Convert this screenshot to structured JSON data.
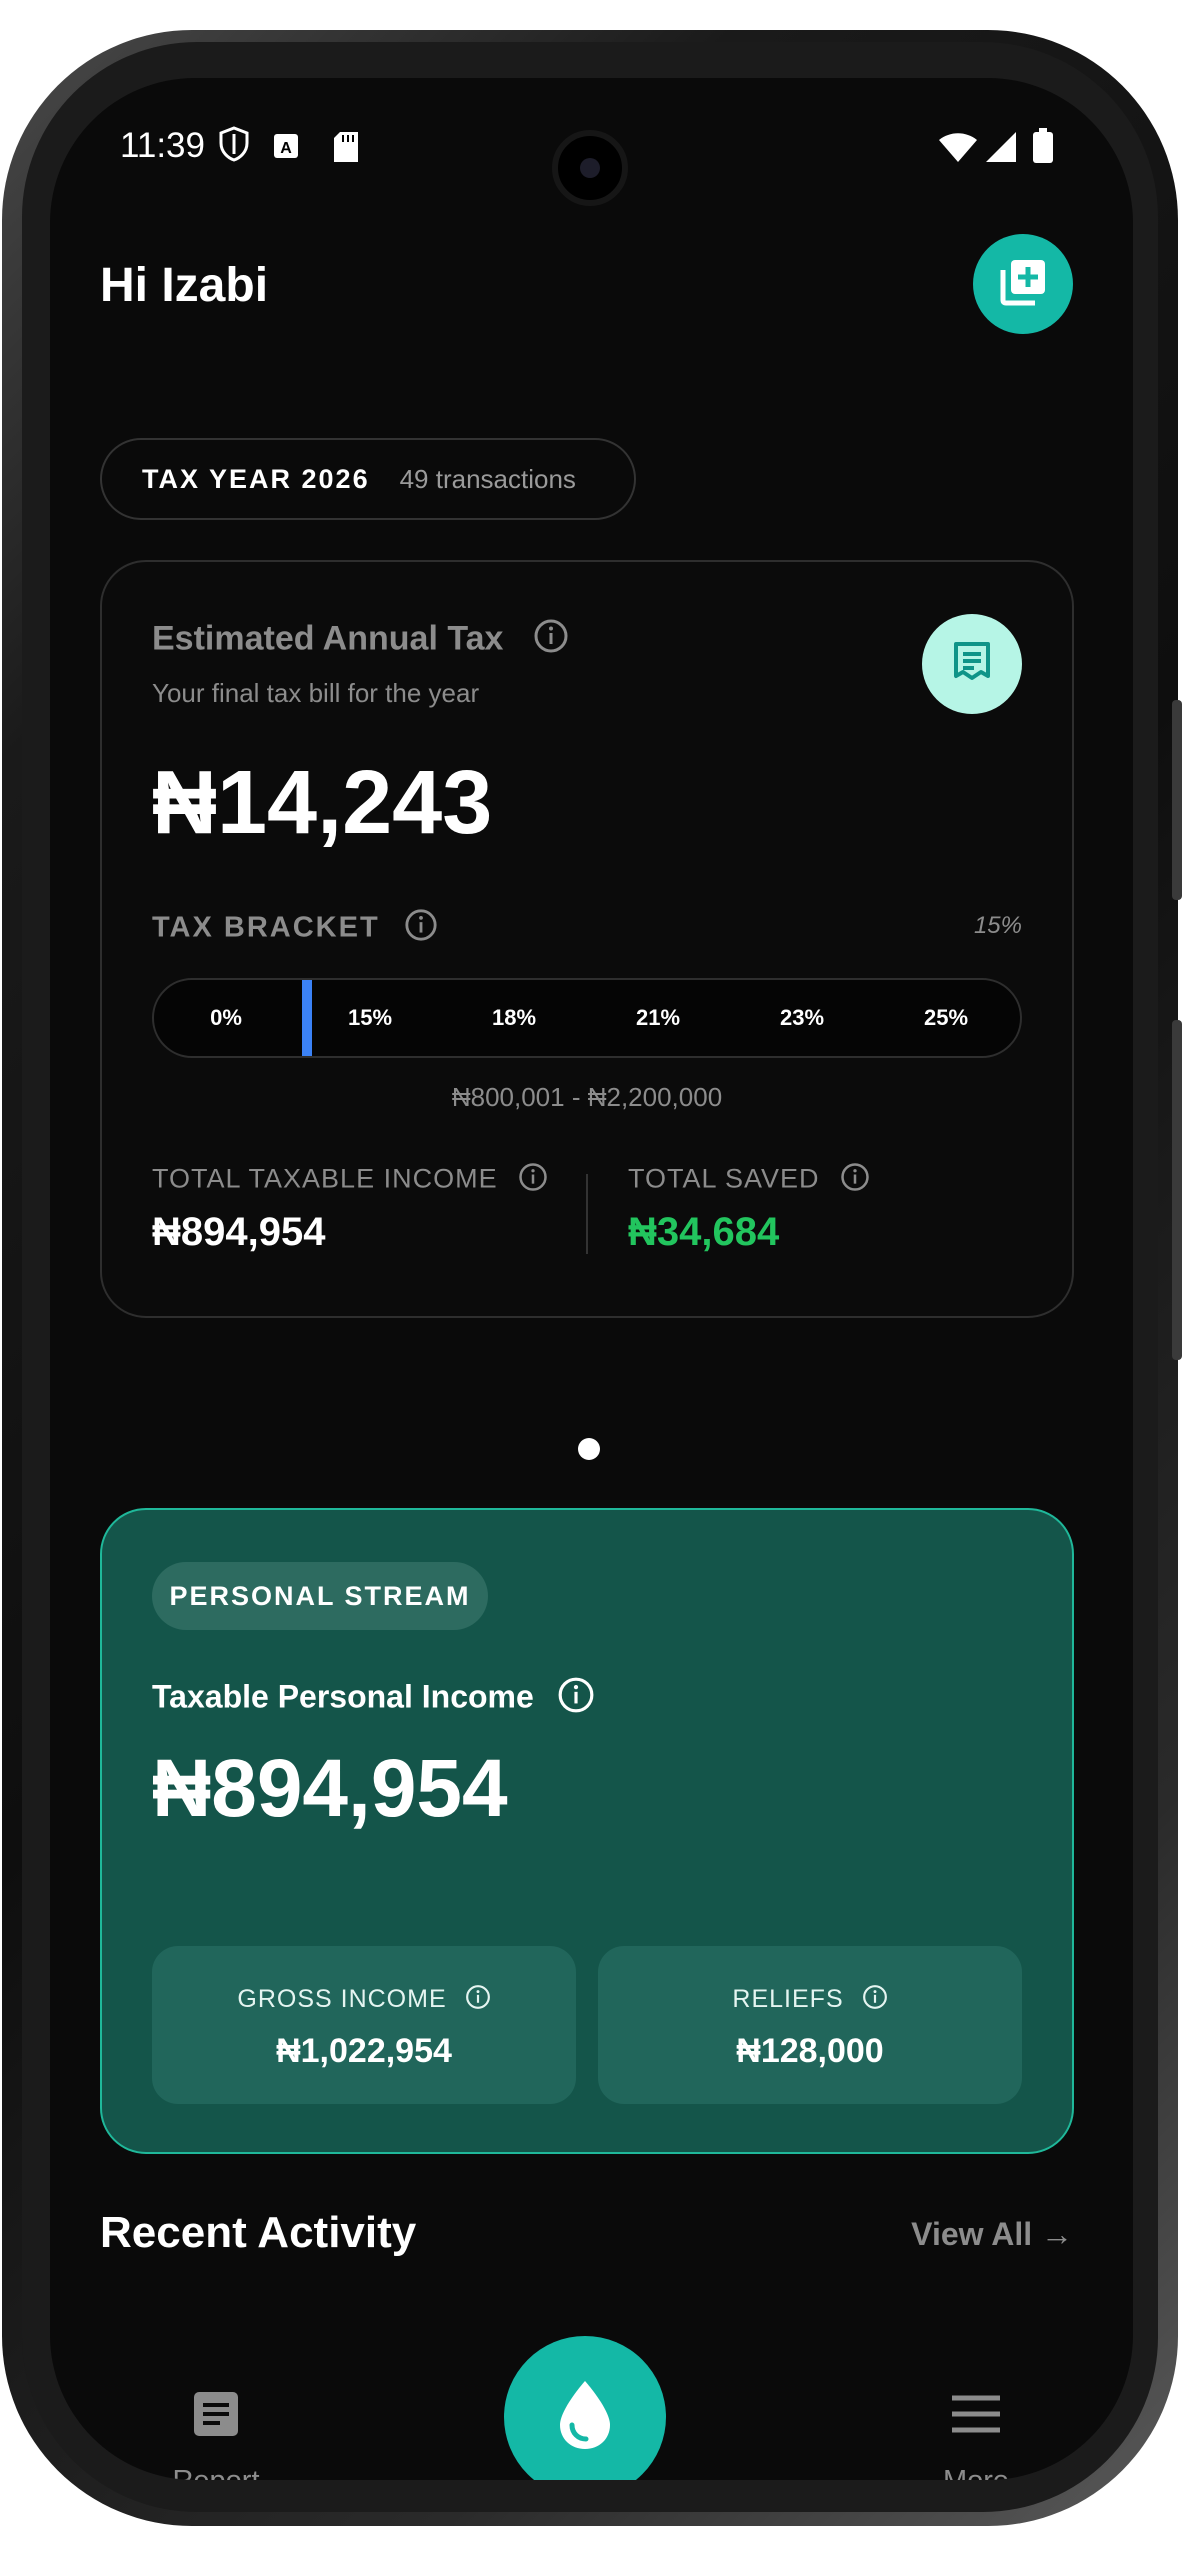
{
  "status_bar": {
    "time": "11:39"
  },
  "header": {
    "greeting": "Hi Izabi"
  },
  "tax_year_pill": {
    "year": "TAX YEAR 2026",
    "transactions": "49 transactions"
  },
  "tax_card": {
    "title": "Estimated Annual Tax",
    "subtitle": "Your final tax bill for the year",
    "amount": "₦14,243",
    "bracket_label": "TAX BRACKET",
    "bracket_rate": "15%",
    "brackets": [
      "0%",
      "15%",
      "18%",
      "21%",
      "23%",
      "25%"
    ],
    "bracket_range": "₦800,001 - ₦2,200,000",
    "total_taxable_income_label": "TOTAL TAXABLE INCOME",
    "total_taxable_income": "₦894,954",
    "total_saved_label": "TOTAL SAVED",
    "total_saved": "₦34,684",
    "saved_color": "#22c55e"
  },
  "stream_card": {
    "badge": "PERSONAL STREAM",
    "title": "Taxable Personal Income",
    "amount": "₦894,954",
    "gross_income_label": "GROSS INCOME",
    "gross_income": "₦1,022,954",
    "reliefs_label": "RELIEFS",
    "reliefs": "₦128,000"
  },
  "recent": {
    "title": "Recent Activity",
    "view_all": "View All →"
  },
  "nav": {
    "report": "Report",
    "more": "More"
  },
  "colors": {
    "accent": "#14b8a6",
    "card_green": "#14554a",
    "bracket_marker": "#3b82f6"
  }
}
